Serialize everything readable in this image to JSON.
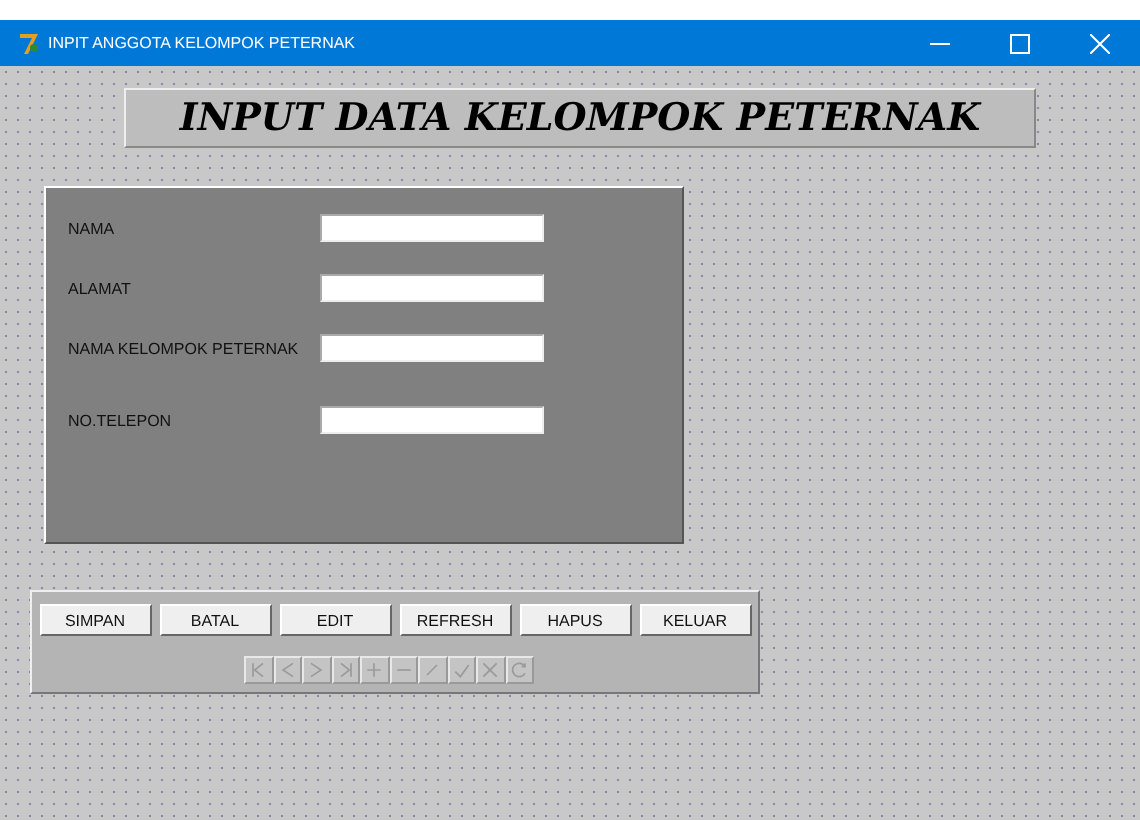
{
  "window": {
    "title": "INPIT ANGGOTA KELOMPOK PETERNAK"
  },
  "banner": "INPUT DATA KELOMPOK PETERNAK",
  "fields": [
    {
      "label": "NAMA"
    },
    {
      "label": "ALAMAT"
    },
    {
      "label": "NAMA KELOMPOK PETERNAK"
    },
    {
      "label": "NO.TELEPON"
    }
  ],
  "buttons": [
    "SIMPAN",
    "BATAL",
    "EDIT",
    "REFRESH",
    "HAPUS",
    "KELUAR"
  ],
  "navigator": {
    "disabled": true,
    "buttons": [
      {
        "kind": "first"
      },
      {
        "kind": "prior"
      },
      {
        "kind": "next"
      },
      {
        "kind": "last"
      },
      {
        "kind": "insert"
      },
      {
        "kind": "delete"
      },
      {
        "kind": "edit"
      },
      {
        "kind": "post"
      },
      {
        "kind": "cancel"
      },
      {
        "kind": "refresh"
      }
    ]
  }
}
